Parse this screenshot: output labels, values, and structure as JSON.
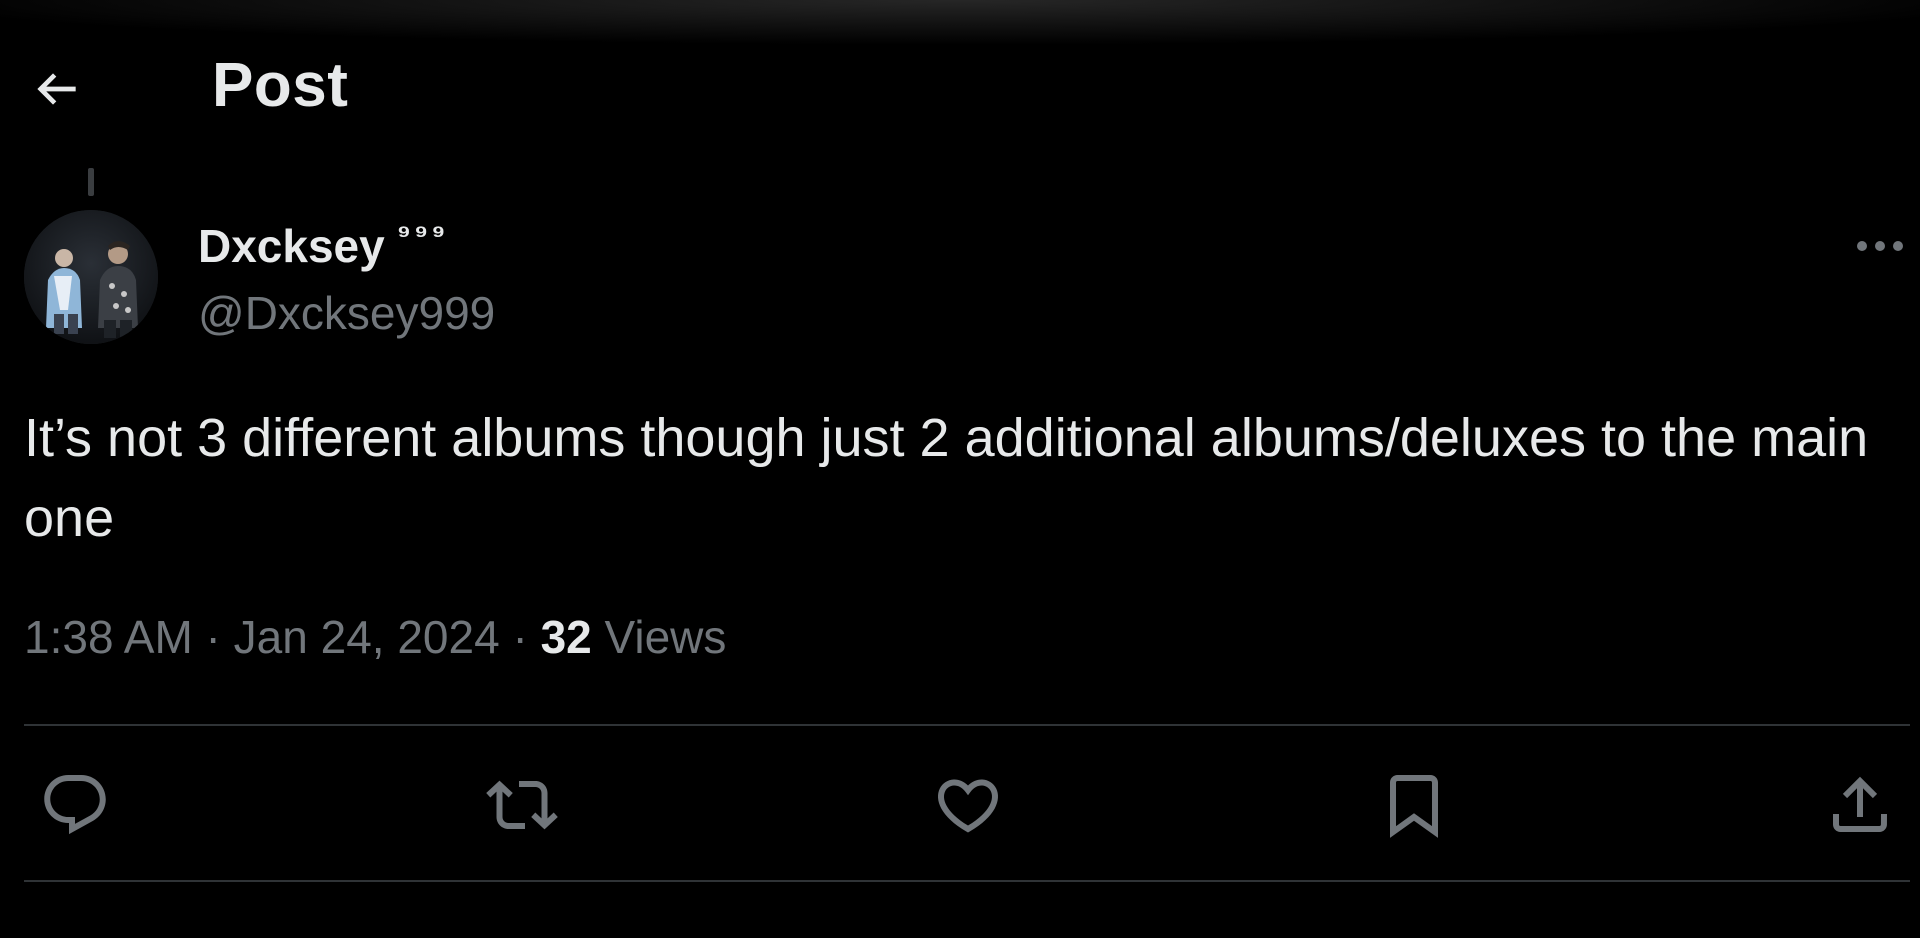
{
  "header": {
    "back_icon": "arrow-left-icon",
    "title": "Post"
  },
  "post": {
    "author": {
      "display_name": "Dxcksey",
      "name_suffix": "⁹⁹⁹",
      "handle": "@Dxcksey999",
      "avatar": "profile-photo"
    },
    "text": "It’s not 3 different albums though just 2 additional albums/deluxes to the main one",
    "meta": {
      "time": "1:38 AM",
      "separator": " · ",
      "date": "Jan 24, 2024",
      "views_count": "32",
      "views_label": "Views"
    },
    "more_icon": "more-horizontal-icon"
  },
  "actions": [
    {
      "name": "reply",
      "icon": "reply-icon"
    },
    {
      "name": "repost",
      "icon": "repost-icon"
    },
    {
      "name": "like",
      "icon": "heart-icon"
    },
    {
      "name": "bookmark",
      "icon": "bookmark-icon"
    },
    {
      "name": "share",
      "icon": "share-icon"
    }
  ],
  "colors": {
    "background": "#000000",
    "text_primary": "#e7e9ea",
    "text_secondary": "#71767b",
    "divider": "#2f3336"
  }
}
